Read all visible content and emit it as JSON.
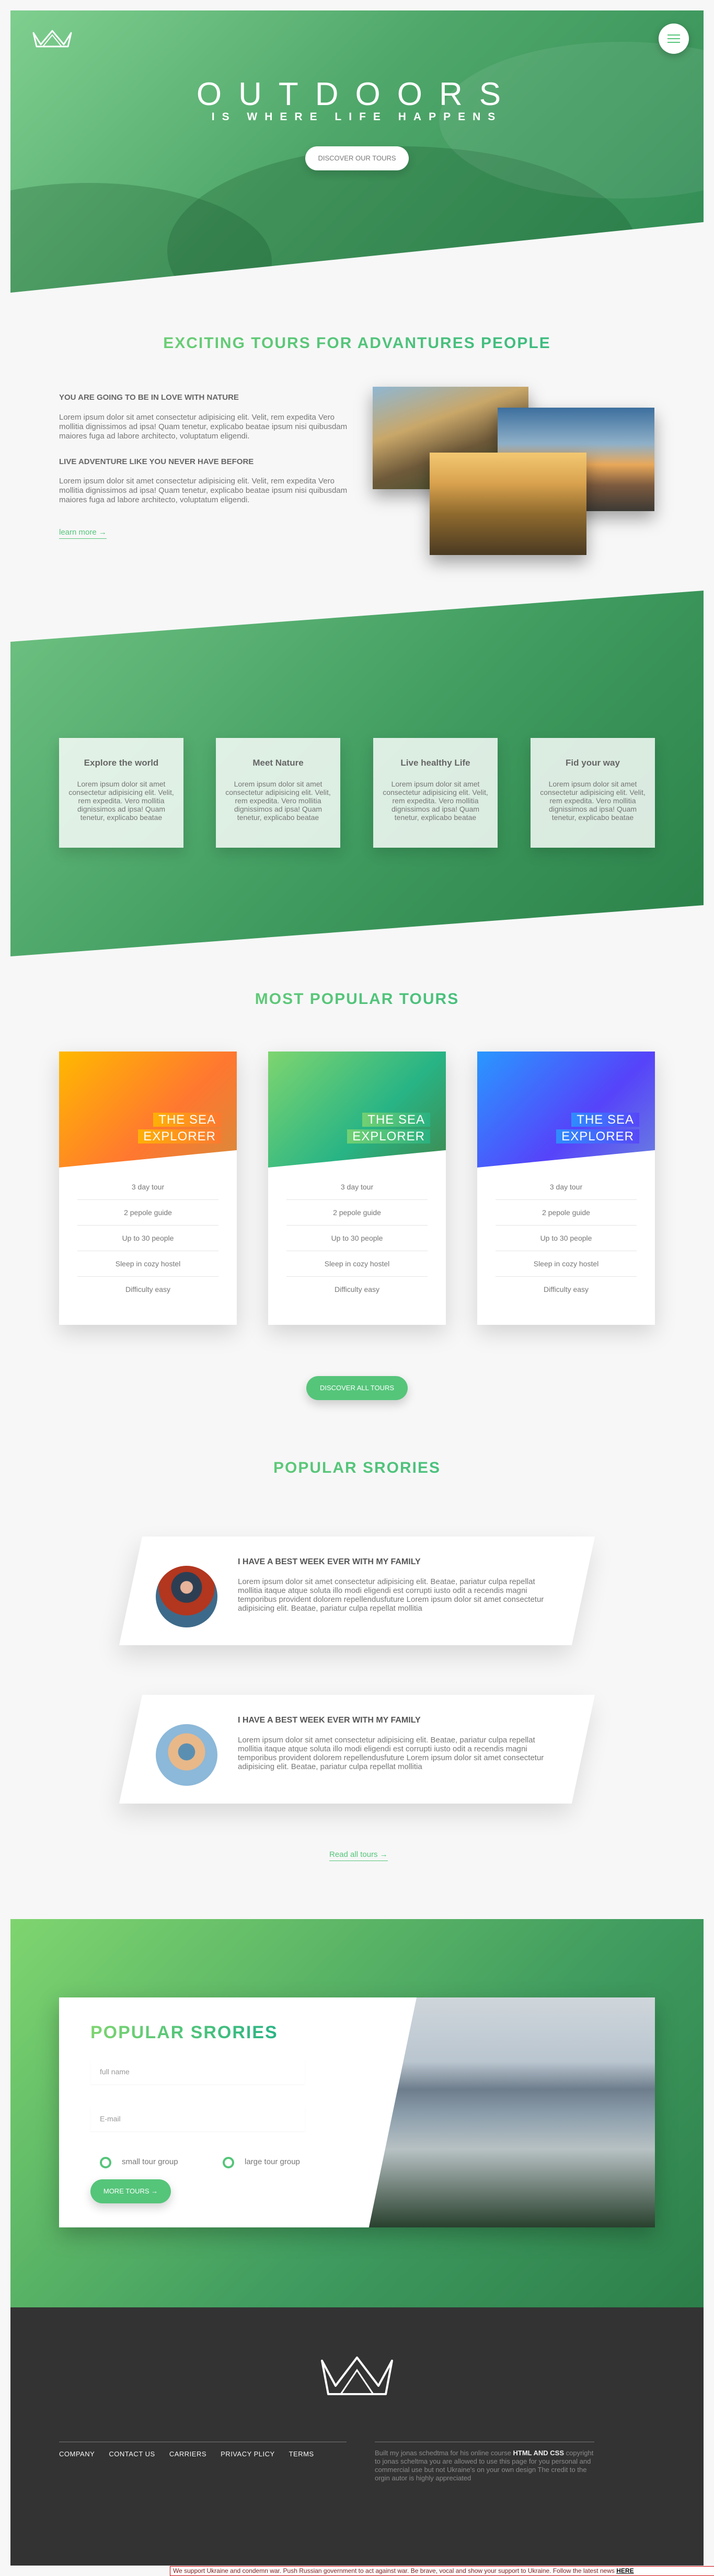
{
  "hero": {
    "title": "OUTDOORS",
    "subtitle": "IS WHERE LIFE HAPPENS",
    "cta": "DISCOVER OUR TOURS"
  },
  "about": {
    "heading": "EXCITING TOURS FOR ADVANTURES PEOPLE",
    "blocks": [
      {
        "title": "YOU ARE GOING TO BE IN LOVE WITH NATURE",
        "text": "Lorem ipsum dolor sit amet consectetur adipisicing elit. Velit, rem expedita Vero mollitia dignissimos ad ipsa! Quam tenetur, explicabo beatae ipsum nisi quibusdam maiores fuga ad labore architecto, voluptatum eligendi."
      },
      {
        "title": "LIVE ADVENTURE LIKE YOU NEVER HAVE BEFORE",
        "text": "Lorem ipsum dolor sit amet consectetur adipisicing elit. Velit, rem expedita Vero mollitia dignissimos ad ipsa! Quam tenetur, explicabo beatae ipsum nisi quibusdam maiores fuga ad labore architecto, voluptatum eligendi."
      }
    ],
    "link": "learn more →"
  },
  "features": [
    {
      "title": "Explore the world",
      "text": "Lorem ipsum dolor sit amet consectetur adipisicing elit. Velit, rem expedita. Vero mollitia dignissimos ad ipsa! Quam tenetur, explicabo beatae"
    },
    {
      "title": "Meet Nature",
      "text": "Lorem ipsum dolor sit amet consectetur adipisicing elit. Velit, rem expedita. Vero mollitia dignissimos ad ipsa! Quam tenetur, explicabo beatae"
    },
    {
      "title": "Live healthy Life",
      "text": "Lorem ipsum dolor sit amet consectetur adipisicing elit. Velit, rem expedita. Vero mollitia dignissimos ad ipsa! Quam tenetur, explicabo beatae"
    },
    {
      "title": "Fid your way",
      "text": "Lorem ipsum dolor sit amet consectetur adipisicing elit. Velit, rem expedita. Vero mollitia dignissimos ad ipsa! Quam tenetur, explicabo beatae"
    }
  ],
  "tours": {
    "heading": "MOST POPULAR TOURS",
    "cards": [
      {
        "title_line1": "THE SEA",
        "title_line2": "EXPLORER",
        "details": [
          "3 day tour",
          "2 pepole guide",
          "Up to 30 people",
          "Sleep in cozy hostel",
          "Difficulty easy"
        ]
      },
      {
        "title_line1": "THE SEA",
        "title_line2": "EXPLORER",
        "details": [
          "3 day tour",
          "2 pepole guide",
          "Up to 30 people",
          "Sleep in cozy hostel",
          "Difficulty easy"
        ]
      },
      {
        "title_line1": "THE SEA",
        "title_line2": "EXPLORER",
        "details": [
          "3 day tour",
          "2 pepole guide",
          "Up to 30 people",
          "Sleep in cozy hostel",
          "Difficulty easy"
        ]
      }
    ],
    "cta": "DISCOVER ALL TOURS"
  },
  "stories": {
    "heading": "POPULAR SRORIES",
    "items": [
      {
        "title": "I HAVE A BEST WEEK EVER WITH MY FAMILY",
        "text": "Lorem ipsum dolor sit amet consectetur adipisicing elit. Beatae, pariatur culpa repellat mollitia itaque atque soluta illo modi eligendi est corrupti iusto odit a recendis magni temporibus provident dolorem repellendusfuture Lorem ipsum dolor sit amet consectetur adipisicing elit. Beatae, pariatur culpa repellat mollitia"
      },
      {
        "title": "I HAVE A BEST WEEK EVER WITH MY FAMILY",
        "text": "Lorem ipsum dolor sit amet consectetur adipisicing elit. Beatae, pariatur culpa repellat mollitia itaque atque soluta illo modi eligendi est corrupti iusto odit a recendis magni temporibus provident dolorem repellendusfuture Lorem ipsum dolor sit amet consectetur adipisicing elit. Beatae, pariatur culpa repellat mollitia"
      }
    ],
    "link": "Read all tours →"
  },
  "booking": {
    "heading": "POPULAR SRORIES",
    "name_placeholder": "full name",
    "email_placeholder": "E-mail",
    "option_small": "small tour group",
    "option_large": "large tour group",
    "submit": "MORE TOURS →"
  },
  "footer": {
    "nav": [
      "COMPANY",
      "CONTACT US",
      "CARRIERS",
      "PRIVACY PLICY",
      "TERMS"
    ],
    "copy_prefix": "Built my jonas schedtma for his online course",
    "copy_course": "HTML AND CSS",
    "copy_rest": "copyright to jonas scheltma you are allowed to use this page for you personal and commercial use but not Ukraine's on your own design The credit to the orgin autor is highly appreciated"
  },
  "banner": {
    "text": "We support Ukraine and condemn war. Push Russian government to act against war. Be brave, vocal and show your support to Ukraine. Follow the latest news",
    "link": "HERE"
  },
  "colors": {
    "primary": "#55c57a",
    "primary_light": "#7ed56f",
    "primary_dark": "#28b485",
    "footer": "#333333"
  }
}
